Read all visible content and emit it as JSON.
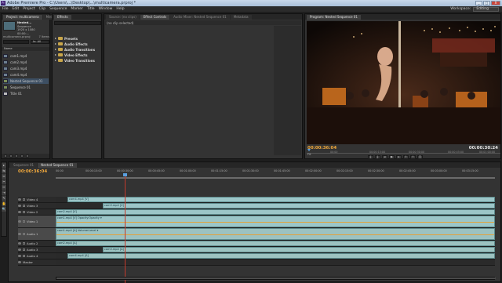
{
  "window": {
    "title": "Adobe Premiere Pro - C:\\Users\\...\\Desktop\\...\\multicamera.prproj *",
    "app_icon": "Pr",
    "buttons": [
      "_",
      "□",
      "X"
    ]
  },
  "menu": [
    "File",
    "Edit",
    "Project",
    "Clip",
    "Sequence",
    "Marker",
    "Title",
    "Window",
    "Help"
  ],
  "workspace": {
    "label": "Workspace:",
    "value": "Editing"
  },
  "project_panel": {
    "tabs": [
      "Project: multicamera",
      "Media"
    ],
    "thumb_name": "Nested...",
    "thumb_info": [
      "Sequence",
      "1920 x 1080",
      "00:00:..."
    ],
    "file_name": "multicamera.prproj",
    "item_count": "7 Items",
    "search_in": "In:",
    "search_dd": "All",
    "column_name": "Name",
    "items": [
      {
        "label": "cam1.mp4",
        "icon": "clip"
      },
      {
        "label": "cam2.mp4",
        "icon": "clip"
      },
      {
        "label": "cam3.mp4",
        "icon": "clip"
      },
      {
        "label": "cam4.mp4",
        "icon": "clip"
      },
      {
        "label": "Nested Sequence 01",
        "icon": "sequence",
        "selected": true
      },
      {
        "label": "Sequence 01",
        "icon": "sequence"
      },
      {
        "label": "Title 01",
        "icon": "title"
      }
    ]
  },
  "effects_panel": {
    "tabs": [
      "Effects"
    ],
    "items": [
      "Presets",
      "Audio Effects",
      "Audio Transitions",
      "Video Effects",
      "Video Transitions"
    ]
  },
  "effect_controls": {
    "tabs": [
      "Source: (no clips)",
      "Effect Controls",
      "Audio Mixer: Nested Sequence 01",
      "Metadata"
    ],
    "no_clip": "(no clip selected)"
  },
  "program_monitor": {
    "tabs": [
      "Program: Nested Sequence 01"
    ],
    "timecode_current": "00:00:36:04",
    "timecode_duration": "00:00:30:24",
    "fit": "Fit",
    "ruler_labels": [
      "00:00",
      "00:00:15:00",
      "00:00:30:00",
      "00:00:45:00",
      "00:01:00:00"
    ]
  },
  "timeline": {
    "tabs": [
      "Sequence 01",
      "Nested Sequence 01"
    ],
    "timecode": "00:00:36:04",
    "ruler_labels": [
      "00:00",
      "00:00:15:00",
      "00:00:30:00",
      "00:00:45:00",
      "00:01:00:00",
      "00:01:15:00",
      "00:01:30:00",
      "00:01:45:00",
      "00:02:00:00",
      "00:02:15:00",
      "00:02:30:00",
      "00:02:45:00",
      "00:03:00:00",
      "00:03:15:00"
    ],
    "tracks": [
      {
        "name": "Video 4",
        "kind": "video",
        "clip": "cam4.mp4 [V]",
        "clip_start": 15
      },
      {
        "name": "Video 3",
        "kind": "video",
        "clip": "cam3.mp4 [V]",
        "clip_start": 60
      },
      {
        "name": "Video 2",
        "kind": "video",
        "clip": "cam2.mp4 [V]",
        "clip_start": 0
      },
      {
        "name": "Video 1",
        "kind": "video1",
        "clip": "cam1.mp4 [V] Opacity:Opacity ▾",
        "clip_start": 0
      },
      {
        "name": "Audio 1",
        "kind": "audio1",
        "clip": "cam1.mp4 [A] Volume:Level ▾",
        "clip_start": 0
      },
      {
        "name": "Audio 2",
        "kind": "audio",
        "clip": "cam2.mp4 [A]",
        "clip_start": 0
      },
      {
        "name": "Audio 3",
        "kind": "audio",
        "clip": "cam3.mp4 [A]",
        "clip_start": 60
      },
      {
        "name": "Audio 4",
        "kind": "audio",
        "clip": "cam4.mp4 [A]",
        "clip_start": 15
      },
      {
        "name": "Master",
        "kind": "master",
        "clip": "",
        "clip_start": 0
      }
    ]
  },
  "tools": [
    "▸",
    "⇆",
    "⇔",
    "✂",
    "↔",
    "⇥",
    "✎",
    "✋",
    "🔍"
  ]
}
